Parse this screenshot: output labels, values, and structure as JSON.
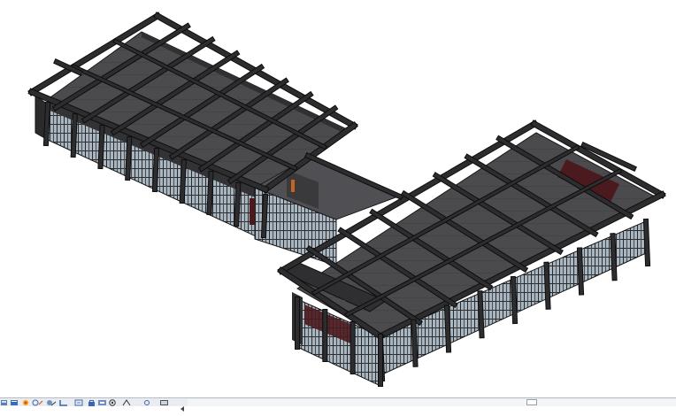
{
  "app": {
    "view_type": "3D View"
  },
  "model": {
    "colors": {
      "frame": "#2d2d2f",
      "frame_edge": "#0d0d0e",
      "roof": "#4c4c4f",
      "wall": "#39393c",
      "glass": "#9fb1bd",
      "accent_red": "#4a1a1e",
      "accent_orange": "#c8641e",
      "sky": "#ffffff"
    }
  },
  "view_control_bar": {
    "icons": [
      "scale-icon",
      "detail-level-icon",
      "visual-style-icon",
      "sun-path-icon",
      "shadows-icon",
      "crop-view-icon",
      "show-crop-icon",
      "lock-view-icon",
      "temporary-hide-icon",
      "reveal-hidden-icon",
      "analytical-model-icon",
      "highlight-displacement-icon",
      "render-icon"
    ],
    "scroll": {
      "position": 0.71
    }
  }
}
